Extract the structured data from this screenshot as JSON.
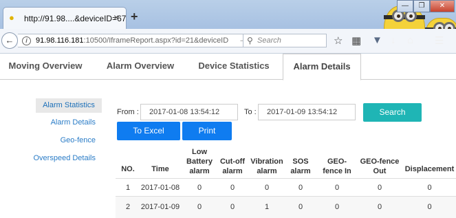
{
  "browser": {
    "tab_title": "http://91.98....&deviceID=67",
    "tab_close": "×",
    "new_tab": "+",
    "url_host": "91.98.116.181",
    "url_rest": ":10500/IframeReport.aspx?id=21&deviceID",
    "search_placeholder": "Search",
    "win_minimize": "—",
    "win_restore": "❐",
    "win_close": "✕"
  },
  "nav": {
    "tabs": [
      "Moving Overview",
      "Alarm Overview",
      "Device Statistics",
      "Alarm Details"
    ],
    "active_index": 3
  },
  "sidebar": {
    "items": [
      "Alarm Statistics",
      "Alarm Details",
      "Geo-fence",
      "Overspeed Details"
    ],
    "active_index": 0
  },
  "form": {
    "from_label": "From :",
    "from_value": "2017-01-08 13:54:12",
    "to_label": "To :",
    "to_value": "2017-01-09 13:54:12",
    "search_label": "Search",
    "excel_label": "To Excel",
    "print_label": "Print"
  },
  "table": {
    "headers": [
      "NO.",
      "Time",
      "Low Battery alarm",
      "Cut-off alarm",
      "Vibration alarm",
      "SOS alarm",
      "GEO-fence In",
      "GEO-fence Out",
      "Displacement"
    ],
    "rows": [
      [
        "1",
        "2017-01-08",
        "0",
        "0",
        "0",
        "0",
        "0",
        "0",
        "0"
      ],
      [
        "2",
        "2017-01-09",
        "0",
        "0",
        "1",
        "0",
        "0",
        "0",
        "0"
      ]
    ]
  },
  "colors": {
    "accent_teal": "#1fb5b5",
    "accent_blue": "#0f7cf0",
    "link_blue": "#2a7cc7"
  }
}
